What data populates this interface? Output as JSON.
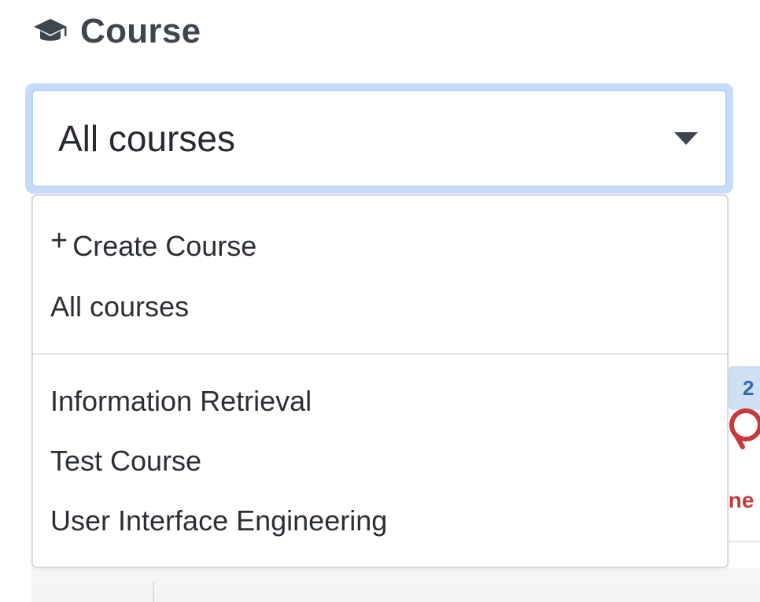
{
  "header": {
    "icon": "graduation-cap-icon",
    "title": "Course"
  },
  "course_select": {
    "value": "All courses",
    "caret_icon": "caret-down-icon"
  },
  "dropdown": {
    "create_label": "Create Course",
    "create_icon": "plus-icon",
    "create_icon_glyph": "+",
    "items_top": [
      {
        "label": "All courses"
      }
    ],
    "items_courses": [
      {
        "label": "Information Retrieval"
      },
      {
        "label": "Test Course"
      },
      {
        "label": "User Interface Engineering"
      }
    ]
  },
  "background": {
    "badge_text": "2",
    "red_text": "ine"
  },
  "colors": {
    "title": "#3d454e",
    "focus_ring": "#c7dcf9",
    "badge_bg": "#cfe0f3",
    "badge_text": "#2c6ab1",
    "alert_red": "#c83a3a"
  }
}
